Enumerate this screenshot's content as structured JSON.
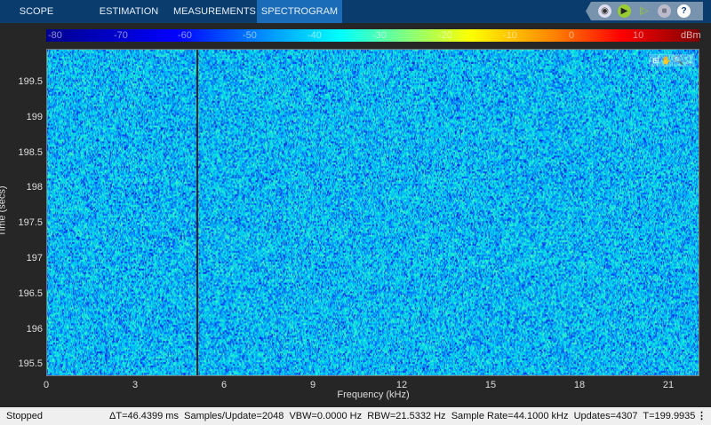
{
  "tabs": [
    {
      "label": "SCOPE",
      "active": false
    },
    {
      "label": "ESTIMATION",
      "active": false
    },
    {
      "label": "MEASUREMENTS",
      "active": false
    },
    {
      "label": "SPECTROGRAM",
      "active": true
    }
  ],
  "toolbar": {
    "icons": [
      "snapshot-icon",
      "run-icon",
      "step-forward-icon",
      "stop-icon",
      "help-icon"
    ],
    "help_glyph": "?"
  },
  "colorbar": {
    "ticks": [
      "-80",
      "-70",
      "-60",
      "-50",
      "-40",
      "-30",
      "-20",
      "-10",
      "0",
      "10"
    ],
    "unit": "dBm",
    "range": [
      -85,
      15
    ]
  },
  "plot": {
    "xlabel": "Frequency (kHz)",
    "ylabel": "Time (secs)",
    "xticks": [
      "0",
      "3",
      "6",
      "9",
      "12",
      "15",
      "18",
      "21"
    ],
    "yticks": [
      "199.5",
      "199",
      "198.5",
      "198",
      "197.5",
      "197",
      "196.5",
      "196",
      "195.5"
    ],
    "xlim": [
      0,
      22.05
    ],
    "ylim": [
      195.34,
      199.98
    ],
    "marker_khz": 5.04
  },
  "status": {
    "state": "Stopped",
    "dt": "ΔT=46.4399 ms",
    "samples": "Samples/Update=2048",
    "vbw": "VBW=0.0000 Hz",
    "rbw": "RBW=21.5332 Hz",
    "rate": "Sample Rate=44.1000 kHz",
    "updates": "Updates=4307",
    "t": "T=199.9935",
    "menu": "⋮"
  }
}
